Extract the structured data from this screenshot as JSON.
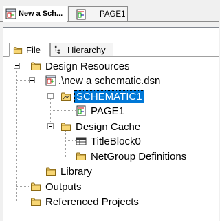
{
  "doc_tabs": [
    {
      "label": "New a Sch...",
      "active": true,
      "icon": "schematic-project-icon"
    },
    {
      "label": "PAGE1",
      "active": false,
      "icon": "schematic-page-icon"
    }
  ],
  "pane_tabs": [
    {
      "label": "File",
      "icon": "folder-icon",
      "active": true
    },
    {
      "label": "Hierarchy",
      "icon": "hierarchy-icon",
      "active": false
    }
  ],
  "tree": {
    "design_resources": "Design Resources",
    "dsn_file": ".\\new a schematic.dsn",
    "schematic1": "SCHEMATIC1",
    "page1": "PAGE1",
    "design_cache": "Design Cache",
    "titleblock0": "TitleBlock0",
    "netgroup_defs": "NetGroup Definitions",
    "library": "Library",
    "outputs": "Outputs",
    "referenced_projects": "Referenced Projects"
  },
  "colors": {
    "selection": "#0078d7",
    "folder": "#f7d674"
  }
}
